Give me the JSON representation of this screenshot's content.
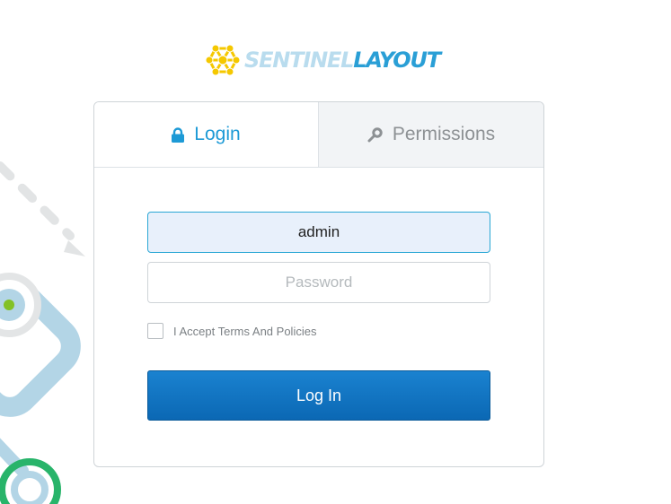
{
  "brand": {
    "part1": "SENTINEL",
    "part2": "LAYOUT",
    "logo_icon": "hexagon-network-icon"
  },
  "tabs": [
    {
      "label": "Login",
      "icon": "lock-icon",
      "active": true
    },
    {
      "label": "Permissions",
      "icon": "key-icon",
      "active": false
    }
  ],
  "form": {
    "username_value": "admin",
    "password_placeholder": "Password",
    "terms_label": "I Accept Terms And Policies",
    "terms_checked": false,
    "submit_label": "Log In"
  },
  "colors": {
    "accent": "#1d9ad6",
    "button": "#1170bd",
    "logo_light": "#b9dcee",
    "logo_dark": "#2a9fd6",
    "logo_mark": "#f5c800"
  }
}
